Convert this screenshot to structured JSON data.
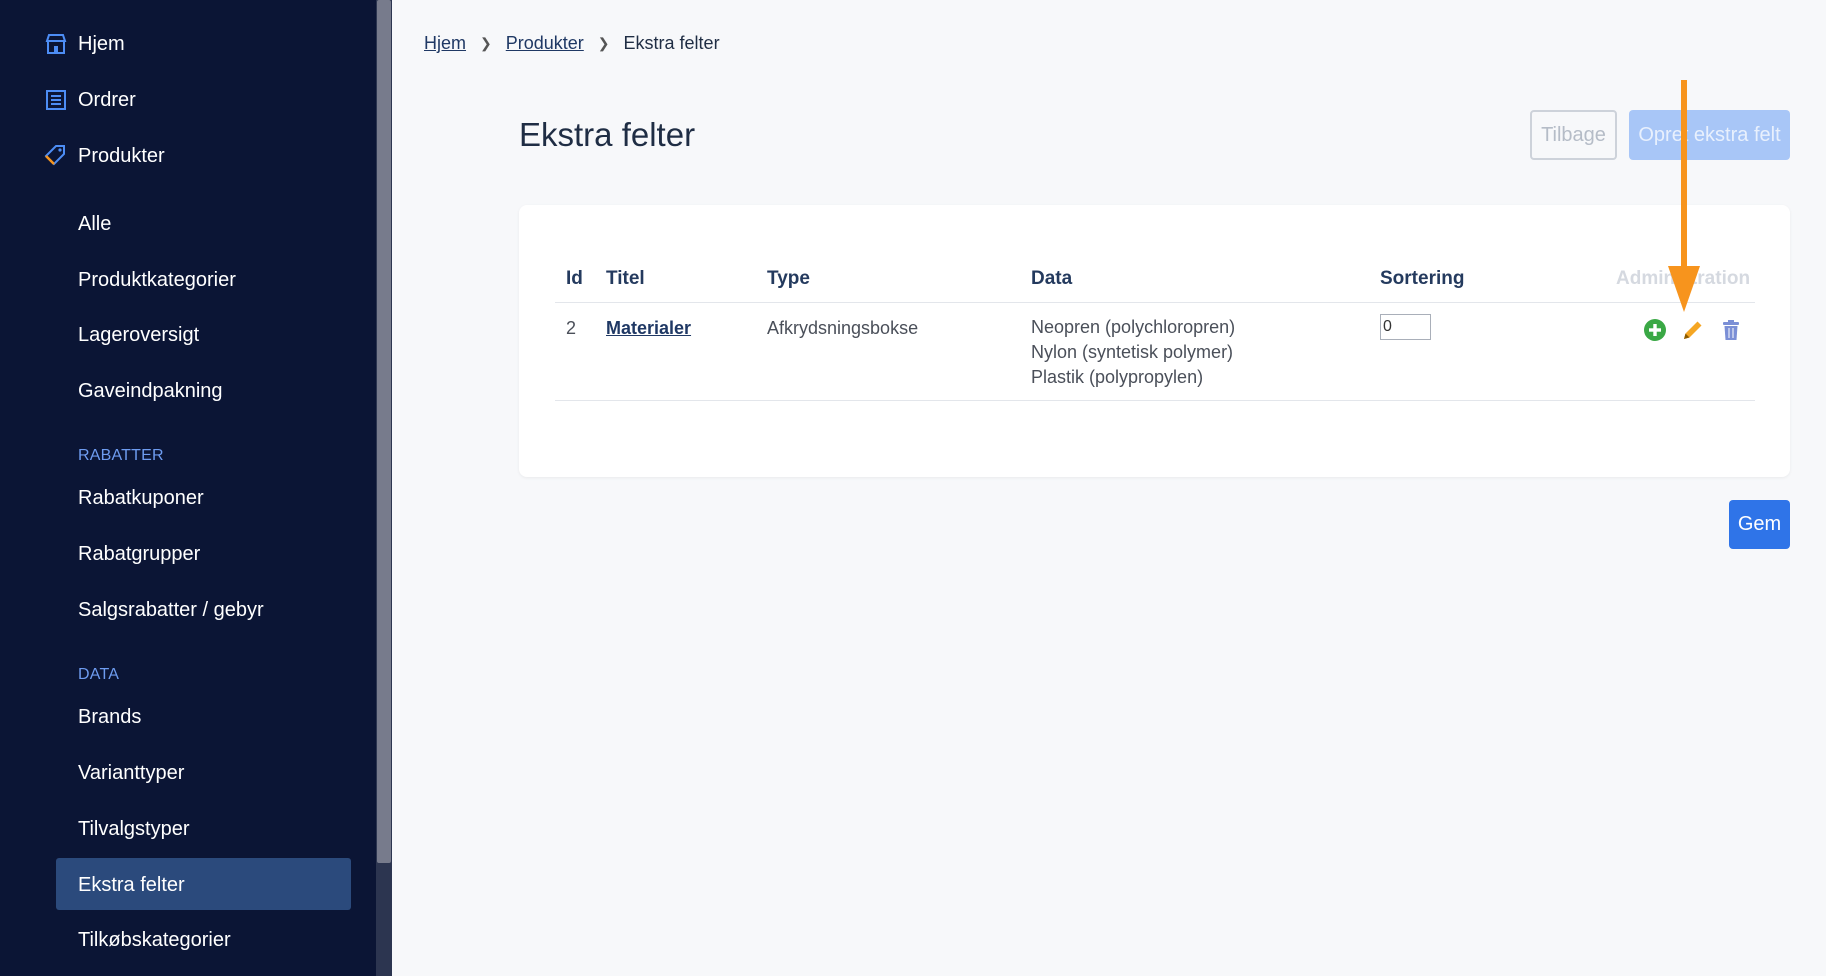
{
  "sidebar": {
    "top": [
      {
        "label": "Hjem",
        "icon": "store-icon"
      },
      {
        "label": "Ordrer",
        "icon": "list-icon"
      },
      {
        "label": "Produkter",
        "icon": "tag-icon"
      }
    ],
    "products": [
      "Alle",
      "Produktkategorier",
      "Lageroversigt",
      "Gaveindpakning"
    ],
    "discounts_heading": "RABATTER",
    "discounts": [
      "Rabatkuponer",
      "Rabatgrupper",
      "Salgsrabatter / gebyr"
    ],
    "data_heading": "DATA",
    "data_items": [
      "Brands",
      "Varianttyper",
      "Tilvalgstyper",
      "Ekstra felter",
      "Tilkøbskategorier"
    ],
    "active_item": "Ekstra felter"
  },
  "breadcrumb": {
    "home": "Hjem",
    "products": "Produkter",
    "current": "Ekstra felter"
  },
  "page": {
    "title": "Ekstra felter",
    "back_label": "Tilbage",
    "create_label": "Opret ekstra felt",
    "save_label": "Gem"
  },
  "table": {
    "headers": {
      "id": "Id",
      "title": "Titel",
      "type": "Type",
      "data": "Data",
      "sorting": "Sortering",
      "admin": "Administration"
    },
    "rows": [
      {
        "id": "2",
        "title": "Materialer",
        "type": "Afkrydsningsbokse",
        "data": [
          "Neopren (polychloropren)",
          "Nylon (syntetisk polymer)",
          "Plastik (polypropylen)"
        ],
        "sorting": "0"
      }
    ]
  },
  "colors": {
    "sidebar_bg": "#0b1535",
    "accent": "#2f74e8",
    "annotation_arrow": "#f7941d",
    "add_icon": "#3aa845",
    "edit_icon": "#f5a623",
    "delete_icon": "#7b8fd6"
  }
}
